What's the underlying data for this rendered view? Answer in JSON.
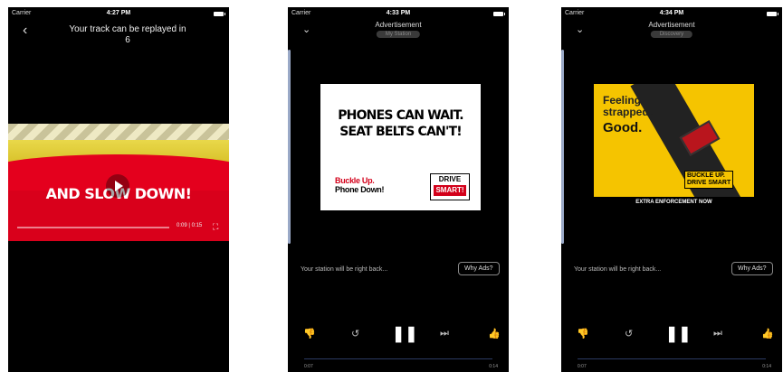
{
  "status": {
    "carrier": "Carrier",
    "times": [
      "4:27 PM",
      "4:33 PM",
      "4:34 PM"
    ]
  },
  "screen1": {
    "title": "Your track can be replayed in",
    "count": "6",
    "video_text": "AND SLOW DOWN!",
    "video_time": "0:09 | 0:15"
  },
  "screen2": {
    "ad_label": "Advertisement",
    "pill": "My Station",
    "ad_line1": "PHONES CAN WAIT.",
    "ad_line2": "SEAT BELTS CAN'T!",
    "ad_buckle1": "Buckle Up.",
    "ad_buckle2": "Phone Down!",
    "ad_drive1": "DRIVE",
    "ad_drive2": "SMART!",
    "station_text": "Your station will be right back...",
    "why_ads": "Why Ads?",
    "elapsed": "0:07",
    "duration": "0:14"
  },
  "screen3": {
    "ad_label": "Advertisement",
    "pill": "Discovery",
    "feel1": "Feeling",
    "feel2": "strapped?",
    "good": "Good.",
    "bu1": "BUCKLE UP.",
    "bu2": "DRIVE SMART",
    "enforcement": "EXTRA ENFORCEMENT NOW",
    "station_text": "Your station will be right back...",
    "why_ads": "Why Ads?",
    "elapsed": "0:07",
    "duration": "0:14"
  },
  "icons": {
    "back": "‹",
    "chevron": "⌄",
    "thumbs_down": "👎",
    "replay": "↺",
    "pause": "❚❚",
    "skip": "⏭",
    "thumbs_up": "👍",
    "fullscreen": "⛶"
  }
}
